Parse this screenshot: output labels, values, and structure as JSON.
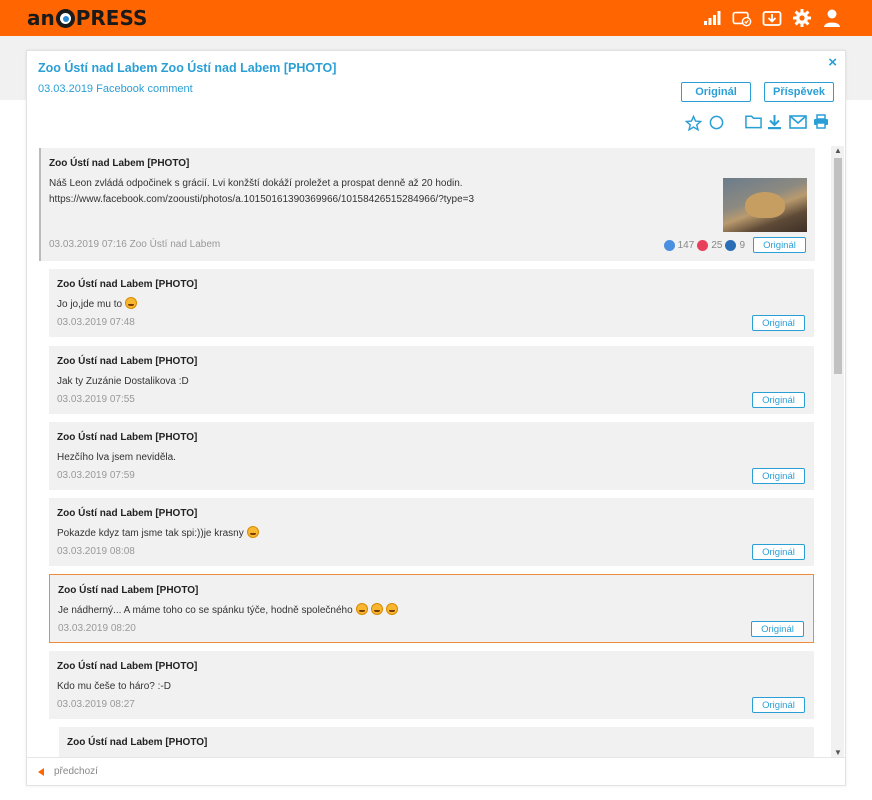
{
  "app": {
    "logo_prefix": "an",
    "logo_suffix": "PRESS",
    "brand_color": "#ff6500",
    "accent_color": "#2a9fd6",
    "top_icons": [
      "signal-bars-icon",
      "cloud-sync-icon",
      "download-box-icon",
      "gear-icon",
      "user-icon"
    ]
  },
  "panel": {
    "close_label": "×",
    "title": "Zoo Ústí nad Labem Zoo Ústí nad Labem [PHOTO]",
    "subtitle": "03.03.2019 Facebook comment",
    "original_button": "Originál",
    "post_button": "Příspěvek",
    "action_icons": [
      "star-icon",
      "circle-icon",
      "folder-icon",
      "download-icon",
      "mail-icon",
      "print-icon"
    ]
  },
  "post": {
    "author": "Zoo Ústí nad Labem [PHOTO]",
    "text_line1": "Náš Leon zvládá odpočinek s grácií. Lvi konžští dokáží proležet a prospat denně až 20 hodin.",
    "text_line2": "https://www.facebook.com/zoousti/photos/a.10150161390369966/10158426515284966/?type=3",
    "meta": "03.03.2019 07:16 Zoo Ústí nad Labem",
    "likes": "147",
    "hearts": "25",
    "comments": "9",
    "original_label": "Originál"
  },
  "comments": [
    {
      "author": "Zoo Ústí nad Labem [PHOTO]",
      "text": "Jo jo,jde mu to",
      "emoji": 1,
      "time": "03.03.2019 07:48",
      "original_label": "Originál"
    },
    {
      "author": "Zoo Ústí nad Labem [PHOTO]",
      "text": "Jak ty Zuzánie Dostalikova :D",
      "emoji": 0,
      "time": "03.03.2019 07:55",
      "original_label": "Originál"
    },
    {
      "author": "Zoo Ústí nad Labem [PHOTO]",
      "text": "Hezčího lva jsem neviděla.",
      "emoji": 0,
      "time": "03.03.2019 07:59",
      "original_label": "Originál"
    },
    {
      "author": "Zoo Ústí nad Labem [PHOTO]",
      "text": "Pokazde kdyz tam jsme tak spi:))je krasny",
      "emoji": 1,
      "time": "03.03.2019 08:08",
      "original_label": "Originál"
    },
    {
      "author": "Zoo Ústí nad Labem [PHOTO]",
      "text": "Je nádherný... A máme toho co se spánku týče, hodně společného",
      "emoji": 3,
      "time": "03.03.2019 08:20",
      "original_label": "Originál",
      "highlighted": true
    },
    {
      "author": "Zoo Ústí nad Labem [PHOTO]",
      "text": "Kdo mu češe to háro? :-D",
      "emoji": 0,
      "time": "03.03.2019 08:27",
      "original_label": "Originál"
    },
    {
      "author": "Zoo Ústí nad Labem [PHOTO]",
      "text": "",
      "emoji": 0,
      "time": "",
      "original_label": ""
    }
  ],
  "footer": {
    "prev_label": "předchozí"
  }
}
